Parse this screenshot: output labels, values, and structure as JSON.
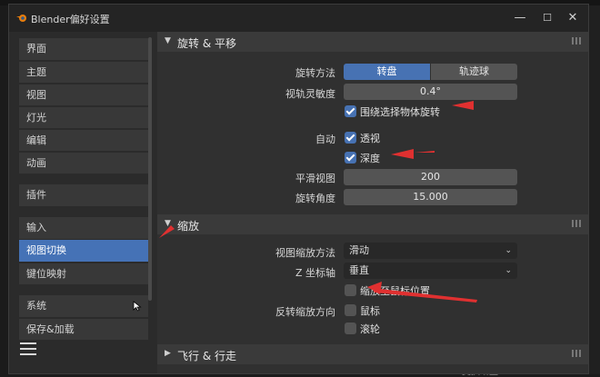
{
  "window": {
    "title": "Blender偏好设置",
    "controls": {
      "close": "✕",
      "minimize": "—",
      "maximize": "☐"
    }
  },
  "sidebar": {
    "items": [
      {
        "label": "界面"
      },
      {
        "label": "主题"
      },
      {
        "label": "视图"
      },
      {
        "label": "灯光"
      },
      {
        "label": "编辑"
      },
      {
        "label": "动画"
      },
      {
        "label": "插件"
      },
      {
        "label": "输入"
      },
      {
        "label": "视图切换"
      },
      {
        "label": "键位映射"
      },
      {
        "label": "系统"
      },
      {
        "label": "保存&加载"
      }
    ],
    "active": "视图切换"
  },
  "sections": {
    "rotate": {
      "title": "旋转 & 平移",
      "orbit_method_label": "旋转方法",
      "orbit_options": [
        "转盘",
        "轨迹球"
      ],
      "orbit_selected": "转盘",
      "sensitivity_label": "视轨灵敏度",
      "sensitivity_value": "0.4°",
      "orbit_around_selection": {
        "label": "围绕选择物体旋转",
        "checked": true
      },
      "auto_label": "自动",
      "auto_perspective": {
        "label": "透视",
        "checked": true
      },
      "auto_depth": {
        "label": "深度",
        "checked": true
      },
      "smooth_view_label": "平滑视图",
      "smooth_view_value": "200",
      "rotation_angle_label": "旋转角度",
      "rotation_angle_value": "15.000"
    },
    "zoom": {
      "title": "缩放",
      "zoom_method_label": "视图缩放方法",
      "zoom_method_value": "滑动",
      "z_axis_label": "Z 坐标轴",
      "z_axis_value": "垂直",
      "zoom_to_mouse": {
        "label": "缩放至鼠标位置",
        "checked": false
      },
      "invert_label": "反转缩放方向",
      "invert_mouse": {
        "label": "鼠标",
        "checked": false
      },
      "invert_wheel": {
        "label": "滚轮",
        "checked": false
      }
    },
    "fly": {
      "title": "飞行 & 行走"
    }
  },
  "background": {
    "bottom_text": "变换增量"
  },
  "colors": {
    "accent": "#4772b3",
    "arrow": "#e03030"
  }
}
